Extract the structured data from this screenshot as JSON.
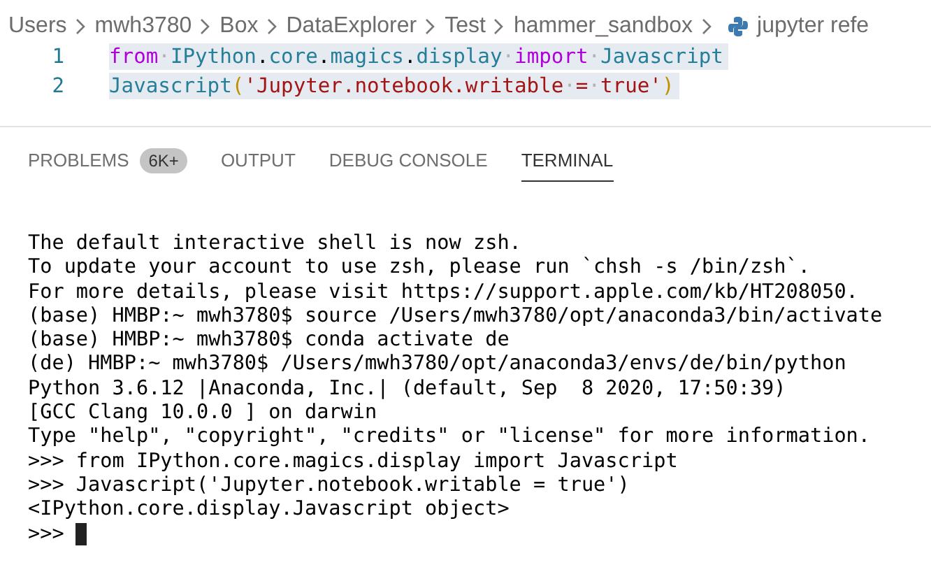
{
  "breadcrumb": {
    "items": [
      "Users",
      "mwh3780",
      "Box",
      "DataExplorer",
      "Test",
      "hammer_sandbox"
    ],
    "file": "jupyter refe"
  },
  "editor": {
    "lines": [
      {
        "number": "1",
        "tokens": [
          {
            "kind": "keyword",
            "text": "from"
          },
          {
            "kind": "whitespace",
            "text": "·"
          },
          {
            "kind": "name",
            "text": "IPython"
          },
          {
            "kind": "plain",
            "text": "."
          },
          {
            "kind": "name",
            "text": "core"
          },
          {
            "kind": "plain",
            "text": "."
          },
          {
            "kind": "name",
            "text": "magics"
          },
          {
            "kind": "plain",
            "text": "."
          },
          {
            "kind": "name",
            "text": "display"
          },
          {
            "kind": "whitespace",
            "text": "·"
          },
          {
            "kind": "keyword",
            "text": "import"
          },
          {
            "kind": "whitespace",
            "text": "·"
          },
          {
            "kind": "name",
            "text": "Javascript"
          }
        ]
      },
      {
        "number": "2",
        "tokens": [
          {
            "kind": "name",
            "text": "Javascript"
          },
          {
            "kind": "bracket",
            "text": "("
          },
          {
            "kind": "string",
            "text": "'Jupyter.notebook.writable"
          },
          {
            "kind": "whitespace",
            "text": "·"
          },
          {
            "kind": "string",
            "text": "="
          },
          {
            "kind": "whitespace",
            "text": "·"
          },
          {
            "kind": "string",
            "text": "true'"
          },
          {
            "kind": "bracket",
            "text": ")"
          }
        ]
      }
    ]
  },
  "panel": {
    "tabs": [
      {
        "label": "PROBLEMS",
        "badge": "6K+",
        "selected": false
      },
      {
        "label": "OUTPUT",
        "selected": false
      },
      {
        "label": "DEBUG CONSOLE",
        "selected": false
      },
      {
        "label": "TERMINAL",
        "selected": true
      }
    ]
  },
  "terminal": {
    "lines": [
      "The default interactive shell is now zsh.",
      "To update your account to use zsh, please run `chsh -s /bin/zsh`.",
      "For more details, please visit https://support.apple.com/kb/HT208050.",
      "(base) HMBP:~ mwh3780$ source /Users/mwh3780/opt/anaconda3/bin/activate",
      "(base) HMBP:~ mwh3780$ conda activate de",
      "(de) HMBP:~ mwh3780$ /Users/mwh3780/opt/anaconda3/envs/de/bin/python",
      "Python 3.6.12 |Anaconda, Inc.| (default, Sep  8 2020, 17:50:39)",
      "[GCC Clang 10.0.0 ] on darwin",
      "Type \"help\", \"copyright\", \"credits\" or \"license\" for more information.",
      ">>> from IPython.core.magics.display import Javascript",
      ">>> Javascript('Jupyter.notebook.writable = true')",
      "<IPython.core.display.Javascript object>"
    ],
    "prompt": ">>>"
  }
}
